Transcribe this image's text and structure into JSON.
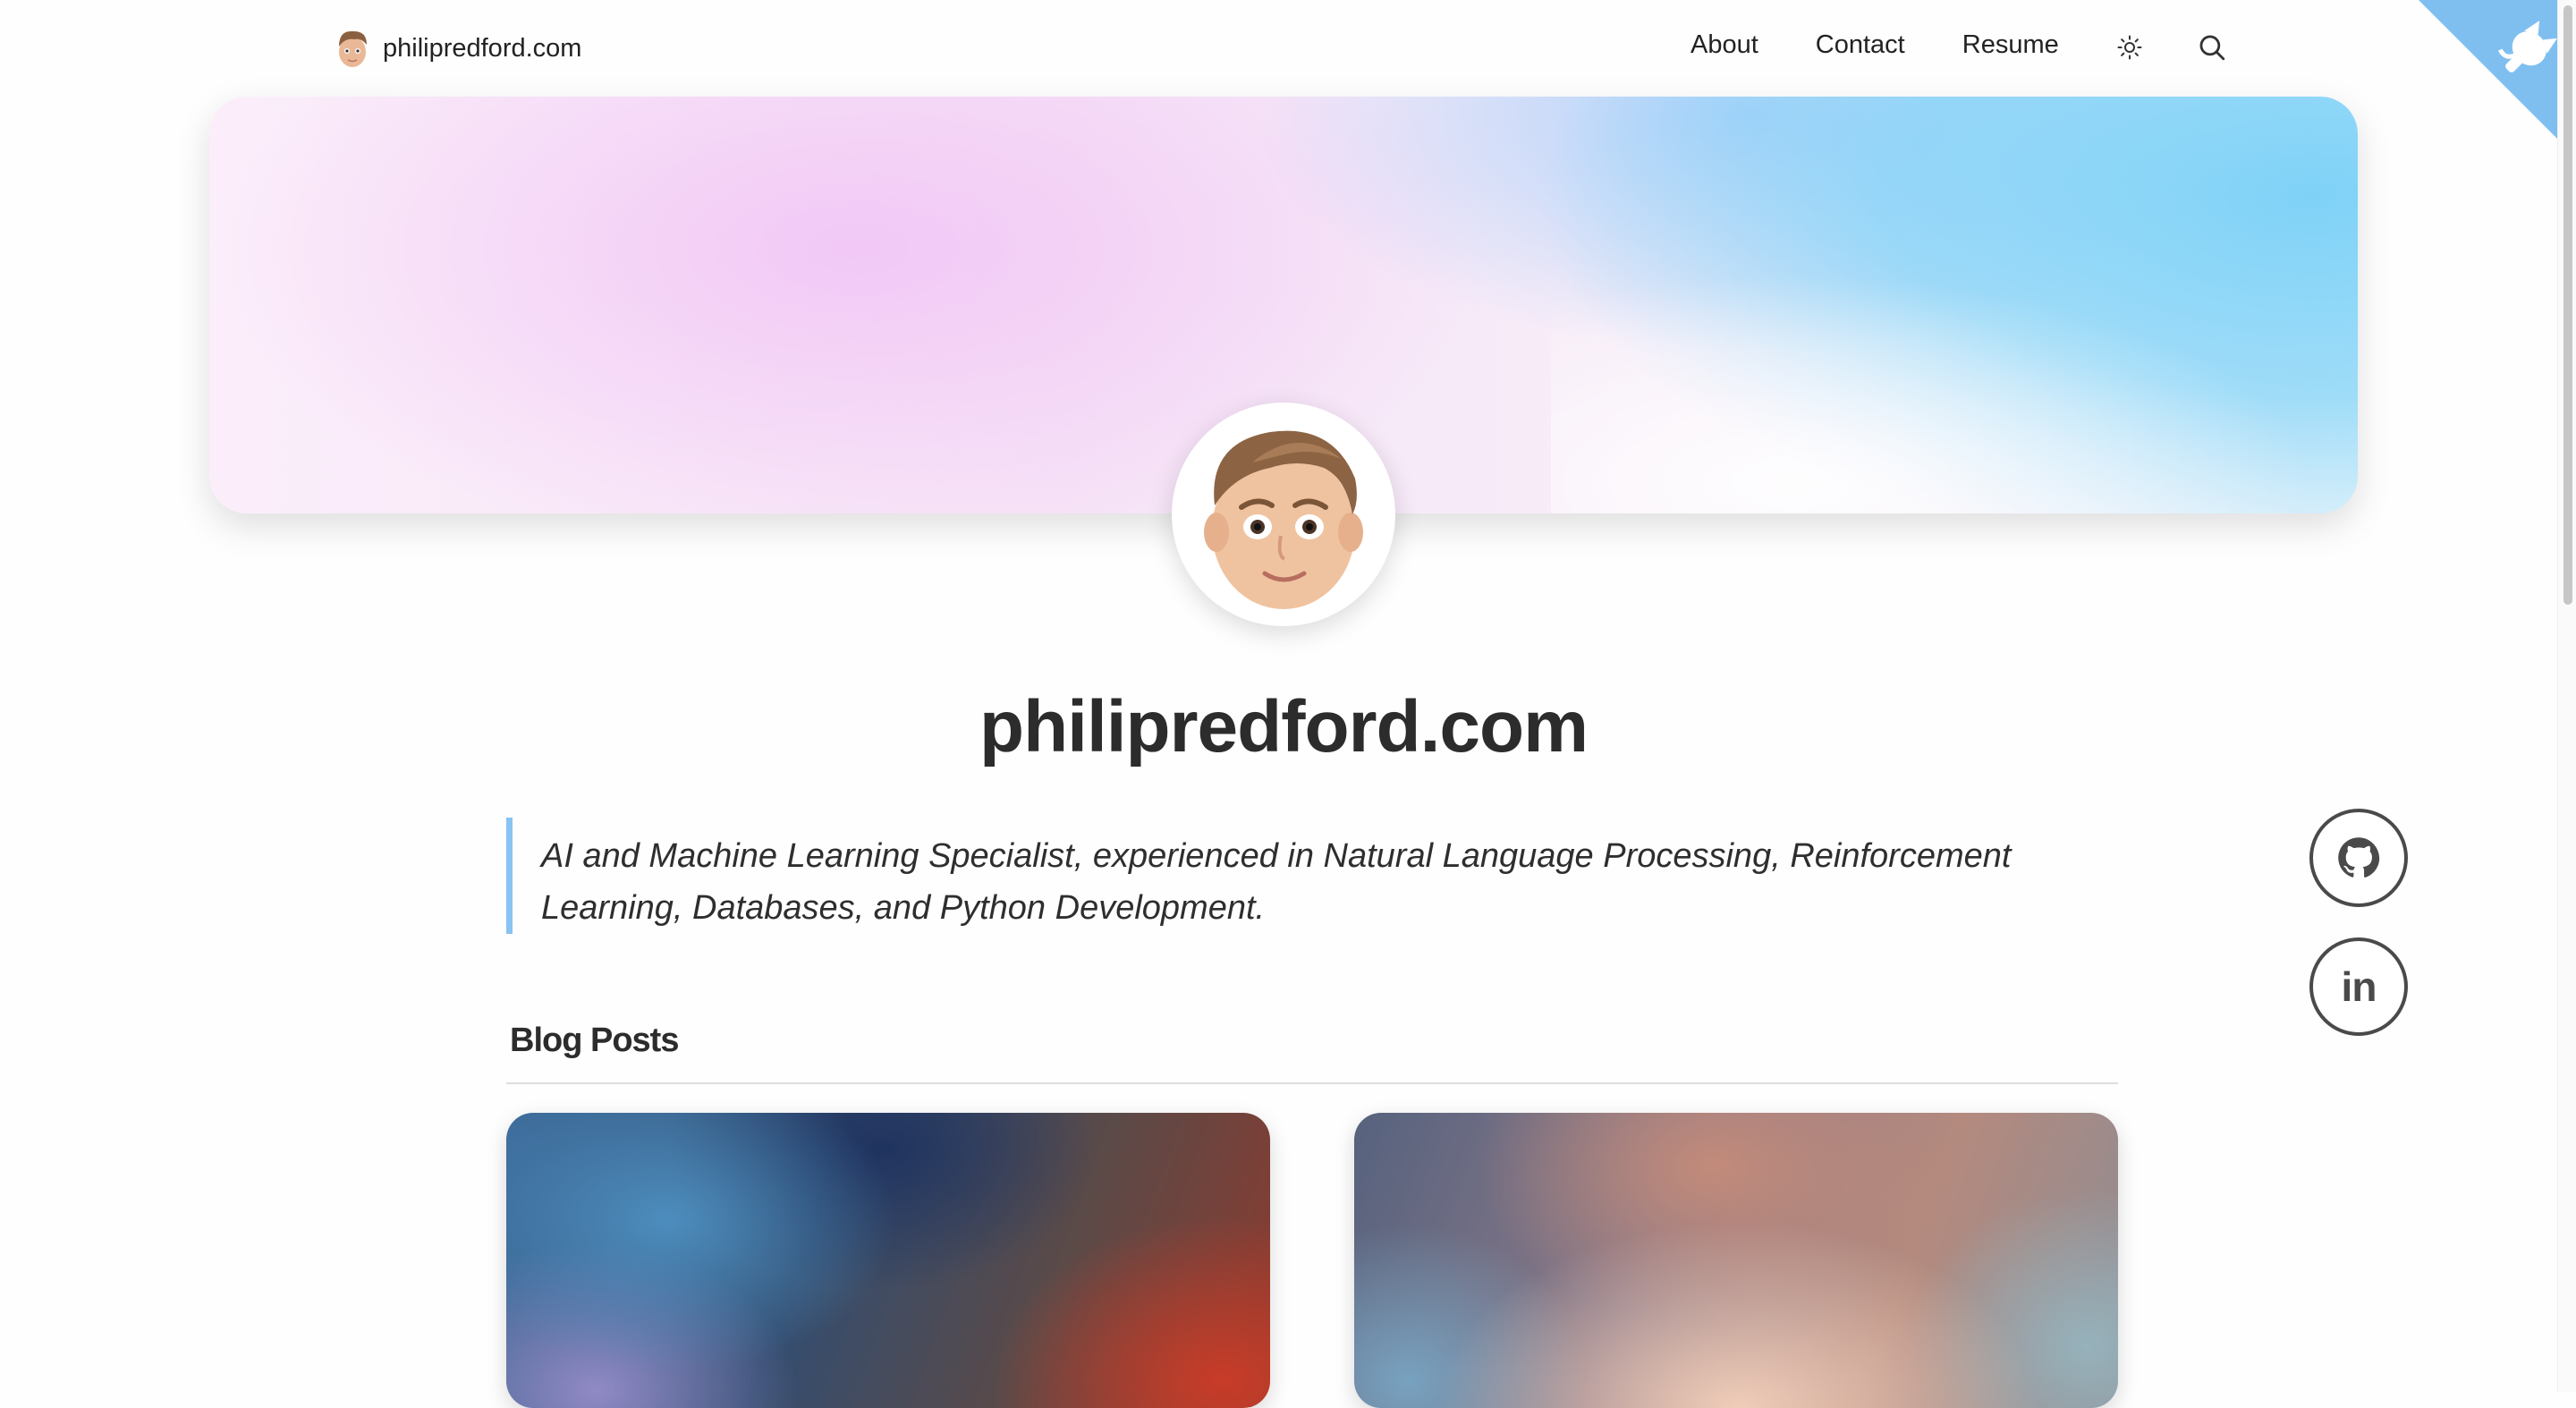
{
  "nav": {
    "brand": "philipredford.com",
    "links": [
      "About",
      "Contact",
      "Resume"
    ],
    "theme_icon": "sun-icon",
    "search_icon": "search-icon"
  },
  "corner": {
    "icon": "octocat-icon",
    "color": "#7fbff0"
  },
  "hero": {
    "colors": [
      "#fbeefa",
      "#f0bef5",
      "#7fd2f7"
    ]
  },
  "profile": {
    "title": "philipredford.com",
    "tagline": "AI and Machine Learning Specialist, experienced in Natural Language Processing, Reinforcement Learning, Databases, and Python Development."
  },
  "social": [
    {
      "name": "GitHub",
      "icon": "github-icon"
    },
    {
      "name": "LinkedIn",
      "icon": "linkedin-icon",
      "label": "in"
    }
  ],
  "blog": {
    "heading": "Blog Posts"
  },
  "colors": {
    "accent": "#87c4f3",
    "text": "#2c2c2c"
  }
}
